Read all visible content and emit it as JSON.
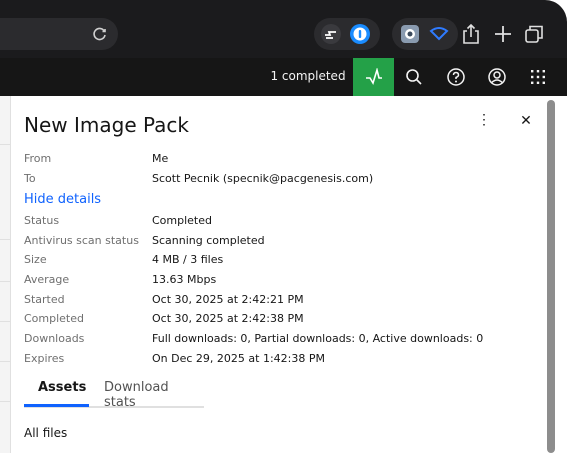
{
  "header": {
    "completed_text": "1 completed"
  },
  "panel": {
    "title": "New Image Pack",
    "menu_glyph": "⋮",
    "close_glyph": "✕",
    "hide_details": "Hide details",
    "from": {
      "label": "From",
      "value": "Me"
    },
    "to": {
      "label": "To",
      "value": "Scott Pecnik (specnik@pacgenesis.com)"
    },
    "details": [
      {
        "label": "Status",
        "value": "Completed"
      },
      {
        "label": "Antivirus scan status",
        "value": "Scanning completed"
      },
      {
        "label": "Size",
        "value": "4 MB / 3 files"
      },
      {
        "label": "Average",
        "value": "13.63 Mbps"
      },
      {
        "label": "Started",
        "value": "Oct 30, 2025 at 2:42:21 PM"
      },
      {
        "label": "Completed",
        "value": "Oct 30, 2025 at 2:42:38 PM"
      },
      {
        "label": "Downloads",
        "value": "Full downloads: 0, Partial downloads: 0, Active downloads: 0"
      },
      {
        "label": "Expires",
        "value": "On Dec 29, 2025 at 1:42:38 PM"
      }
    ],
    "tabs": [
      {
        "label": "Assets",
        "active": true
      },
      {
        "label": "Download stats",
        "active": false
      }
    ],
    "section_title": "All files"
  },
  "colors": {
    "accent": "#0f62fe",
    "activity": "#24a148",
    "header_bg": "#161616"
  }
}
